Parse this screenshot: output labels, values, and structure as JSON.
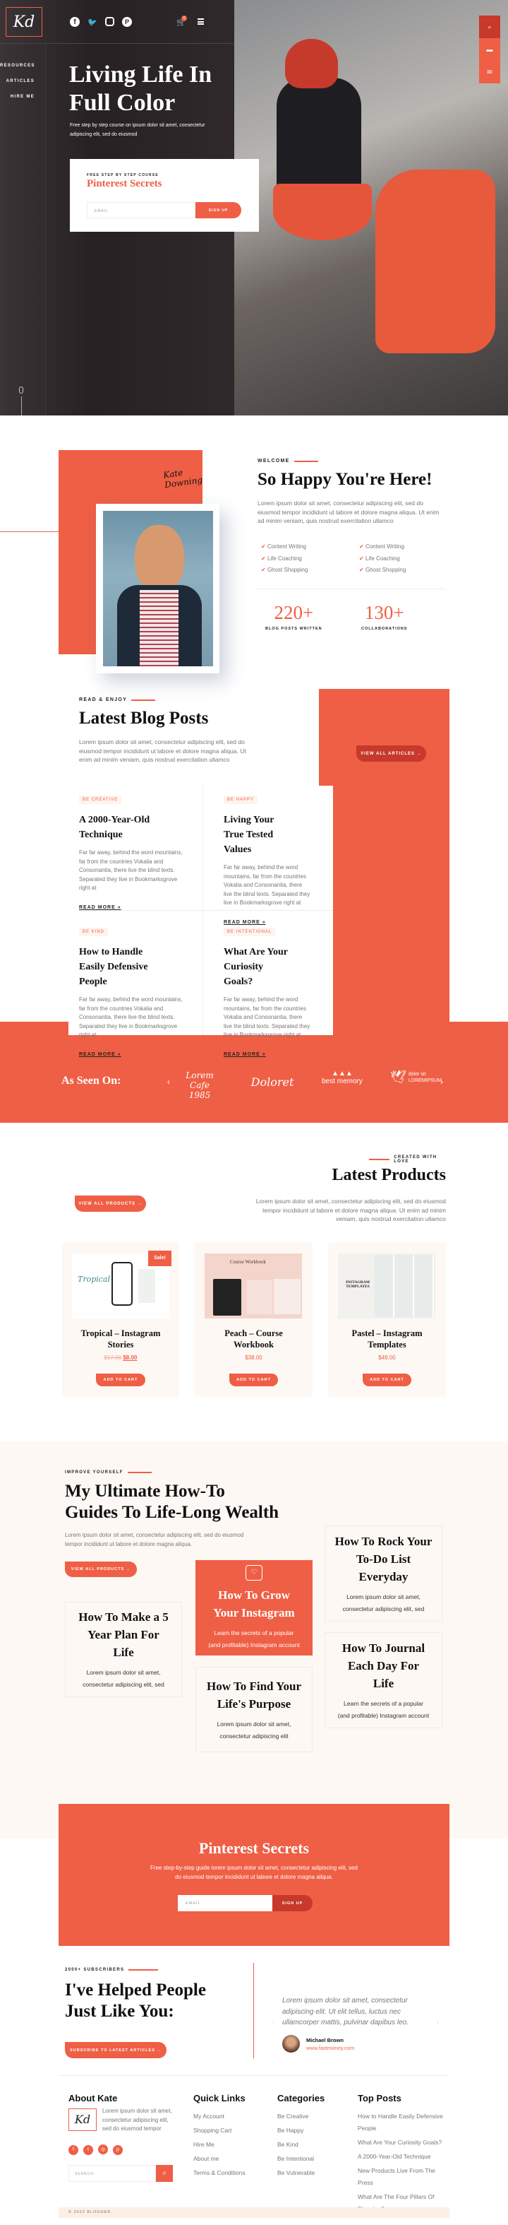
{
  "colors": {
    "accent": "#ef5f45",
    "accent_dark": "#c7392a",
    "cream": "#fdf8f4",
    "dark": "#2c2628"
  },
  "header": {
    "logo": "Kd",
    "social_icons": [
      "facebook-icon",
      "twitter-icon",
      "instagram-icon",
      "pinterest-icon"
    ],
    "cart_count": "0",
    "nav": [
      "RESOURCES",
      "ARTICLES",
      "HIRE ME"
    ],
    "side_widget": [
      "search-icon",
      "store-icon",
      "mail-icon"
    ]
  },
  "hero": {
    "title_line1": "Living Life In",
    "title_line2": "Full Color",
    "subtitle": "Free step by step course on ipsum dolor sit amet, consectetur adipiscing elit, sed do eiusmod",
    "form": {
      "kicker": "FREE STEP BY STEP COURSE",
      "title": "Pinterest Secrets",
      "email_placeholder": "EMAIL",
      "button": "SIGN UP"
    }
  },
  "welcome": {
    "signature": "Kate Downing",
    "kicker": "WELCOME",
    "title": "So Happy You're Here!",
    "text": "Lorem ipsum dolor sit amet, consectetur adipiscing elit, sed do eiusmod tempor incididunt ut labore et dolore magna aliqua. Ut enim ad minim veniam, quis nostrud exercitation ullamco",
    "checklist_left": [
      "Content Writing",
      "Life Coaching",
      "Ghost Shopping"
    ],
    "checklist_right": [
      "Content Writing",
      "Life Coaching",
      "Ghost Shopping"
    ],
    "stats": [
      {
        "value": "220+",
        "label": "BLOG POSTS WRITTEN"
      },
      {
        "value": "130+",
        "label": "COLLABORATIONS"
      }
    ]
  },
  "blog": {
    "kicker": "READ & ENJOY",
    "title": "Latest Blog Posts",
    "text": "Lorem ipsum dolor sit amet, consectetur adipiscing elit, sed do eiusmod tempor incididunt ut labore et dolore magna aliqua. Ut enim ad minim veniam, quis nostrud exercitation ullamco",
    "button": "VIEW ALL ARTICLES →",
    "posts": [
      {
        "tag": "BE CREATIVE",
        "title": "A 2000-Year-Old Technique",
        "excerpt": "Far far away, behind the word mountains, far from the countries Vokalia and Consonantia, there live the blind texts. Separated they live in Bookmarksgrove right at",
        "more": "READ MORE »"
      },
      {
        "tag": "BE HAPPY",
        "title": "Living Your True Tested Values",
        "excerpt": "Far far away, behind the word mountains, far from the countries Vokalia and Consonantia, there live the blind texts. Separated they live in Bookmarksgrove right at",
        "more": "READ MORE »"
      },
      {
        "tag": "BE KIND",
        "title": "How to Handle Easily Defensive People",
        "excerpt": "Far far away, behind the word mountains, far from the countries Vokalia and Consonantia, there live the blind texts. Separated they live in Bookmarksgrove right at",
        "more": "READ MORE »"
      },
      {
        "tag": "BE INTENTIONAL",
        "title": "What Are Your Curiosity Goals?",
        "excerpt": "Far far away, behind the word mountains, far from the countries Vokalia and Consonantia, there live the blind texts. Separated they live in Bookmarksgrove right at",
        "more": "READ MORE »"
      }
    ]
  },
  "seen_on": {
    "title": "As Seen On:",
    "logos": [
      "Lorem Cafe 1985",
      "Doloret",
      "best memory",
      "dolor sit LOREMIPSUM"
    ]
  },
  "products": {
    "kicker": "CREATED WITH LOVE",
    "title": "Latest Products",
    "text": "Lorem ipsum dolor sit amet, consectetur adipiscing elit, sed do eiusmod tempor incididunt ut labore et dolore magna aliqua. Ut enim ad minim veniam, quis nostrud exercitation ullamco",
    "button": "VIEW ALL PRODUCTS →",
    "items": [
      {
        "name": "Tropical – Instagram Stories",
        "old_price": "$17.00",
        "price": "$8.00",
        "badge": "Sale!",
        "image_text": "Tropical",
        "cta": "ADD TO CART"
      },
      {
        "name": "Peach – Course Workbook",
        "price": "$38.00",
        "image_text": "Course Workbook",
        "cta": "ADD TO CART"
      },
      {
        "name": "Pastel – Instagram Templates",
        "price": "$49.00",
        "image_text": "INSTAGRAM TEMPLATES",
        "cta": "ADD TO CART"
      }
    ]
  },
  "guides": {
    "kicker": "IMPROVE YOURSELF",
    "title_line1": "My Ultimate How-To",
    "title_line2": "Guides To Life-Long Wealth",
    "text": "Lorem ipsum dolor sit amet, consectetur adipiscing elit, sed do eiusmod tempor incididunt ut labore et dolore magna aliqua.",
    "button": "VIEW ALL PRODUCTS →",
    "cards": [
      {
        "title": "How To Make a 5 Year Plan For Life",
        "text": "Lorem ipsum dolor sit amet, consectetur adipiscing elit, sed"
      },
      {
        "title": "How To Grow Your Instagram",
        "text": "Learn the secrets of a popular (and profitable) Instagram account"
      },
      {
        "title": "How To Find Your Life's Purpose",
        "text": "Lorem ipsum dolor sit amet, consectetur adipiscing elit"
      },
      {
        "title": "How To Rock Your To-Do List Everyday",
        "text": "Lorem ipsum dolor sit amet, consectetur adipiscing elit, sed"
      },
      {
        "title": "How To Journal Each Day For Life",
        "text": "Learn the secrets of a popular (and profitable) Instagram account"
      }
    ]
  },
  "optin": {
    "title": "Pinterest Secrets",
    "text": "Free step-by-step guide lorem ipsum dolor sit amet, consectetur adipiscing elit, sed do eiusmod tempor incididunt ut labore et dolore magna aliqua.",
    "email_placeholder": "EMAIL",
    "button": "SIGN UP"
  },
  "testimonial": {
    "kicker": "2000+ SUBSCRIBERS",
    "title_line1": "I've Helped People",
    "title_line2": "Just Like You:",
    "button": "SUBSCRIBE TO LATEST ARTICLES →",
    "quote": "Lorem ipsum dolor sit amet, consectetur adipiscing elit. Ut elit tellus, luctus nec ullamcorper mattis, pulvinar dapibus leo.",
    "author": "Michael Brown",
    "site": "www.fastmoney.com"
  },
  "footer": {
    "about": {
      "title": "About Kate",
      "logo": "Kd",
      "text": "Lorem ipsum dolor sit amet, consectetur adipiscing elit, sed do eiusmod tempor",
      "search_placeholder": "SEARCH..."
    },
    "quick_links": {
      "title": "Quick Links",
      "items": [
        "My Account",
        "Shopping Cart",
        "Hire Me",
        "About me",
        "Terms & Conditions"
      ]
    },
    "categories": {
      "title": "Categories",
      "items": [
        "Be Creative",
        "Be Happy",
        "Be Kind",
        "Be Intentional",
        "Be Vulnerable"
      ]
    },
    "top_posts": {
      "title": "Top Posts",
      "items": [
        "How to Handle Easily Defensive People",
        "What Are Your Curiosity Goals?",
        "A 2000-Year-Old Technique",
        "New Products Live From The Press",
        "What Are The Four Pillars Of Blogging?"
      ]
    },
    "copyright": "© 2022 BLOGHER"
  }
}
